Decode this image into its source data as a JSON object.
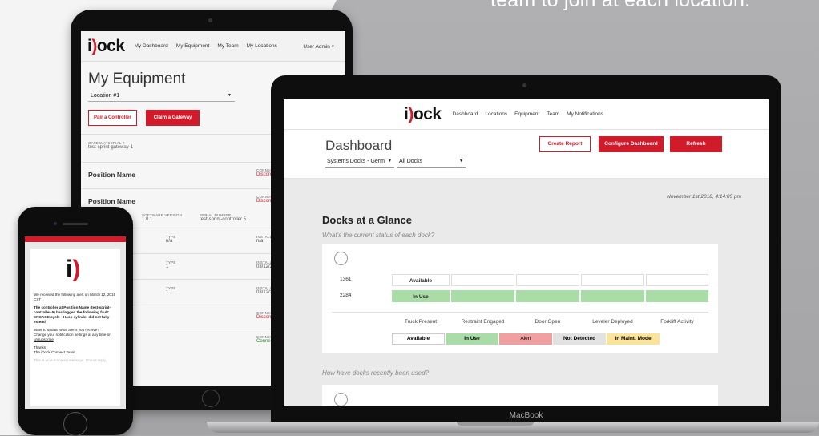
{
  "tagline": "team to join at each location.",
  "tablet": {
    "logo_left": "i",
    "logo_right": "ock",
    "nav": [
      "My Dashboard",
      "My Equipment",
      "My Team",
      "My Locations"
    ],
    "user": "User Admin ▾",
    "title": "My Equipment",
    "location_select": "Location #1",
    "pair_button": "Pair a Controller",
    "claim_button": "Claim a Gateway",
    "gateway_label": "GATEWAY SERIAL #",
    "gateway_value": "test-sprint-gateway-1",
    "position1": "Position Name",
    "connection_label": "CONNECTIV",
    "disconnected": "Disconne",
    "position2": "Position Name",
    "type_label_fragment": "E",
    "software_label": "SOFTWARE VERSION",
    "software_value": "1.0.1",
    "serial_label": "SERIAL NUMBER",
    "serial_value": "test-sprint-controller 5",
    "rows": [
      {
        "type_label": "TYPE",
        "type_value": "n/a",
        "install_label": "INSTALL D",
        "install_value": "n/a"
      },
      {
        "type_label": "TYPE",
        "type_value": "1",
        "install_label": "INSTALL D",
        "install_value": "03/12/20"
      },
      {
        "type_label": "TYPE",
        "type_value": "1",
        "install_label": "INSTALL D",
        "install_value": "03/12/20"
      }
    ],
    "conn_rows": [
      {
        "label": "CONNECTIV",
        "value": "Disconne",
        "fragment": "e",
        "status": "red"
      },
      {
        "label": "CONNECTIV",
        "value": "Connecte",
        "fragment": "e",
        "status": "green"
      }
    ]
  },
  "phone": {
    "intro": "We received the following alert on March 12, 2019 CST",
    "alert": "The controller at Position Name (test-sprint-controller-5) has logged the following fault: ENGAGE cycle - Hook cylinder did not fully extend",
    "update_q": "Want to update what alerts you receive?",
    "link1": "Change your notification settings",
    "link_mid": " at any time or ",
    "link2": "unsubscribe",
    "thanks": "Thanks,",
    "team": "The iDock Connect Team",
    "footer": "This is an automated message. Do not reply."
  },
  "laptop": {
    "logo_left": "i",
    "logo_right": "ock",
    "nav": [
      "Dashboard",
      "Locations",
      "Equipment",
      "Team",
      "My Notifications"
    ],
    "title": "Dashboard",
    "select1": "Systems Docks - Germ",
    "select2": "All Docks",
    "create_report": "Create Report",
    "configure": "Configure Dashboard",
    "refresh": "Refresh",
    "date": "November 1st 2018, 4:14:05 pm",
    "section_title": "Docks at a Glance",
    "question1": "What's the current status of each dock?",
    "info": "i",
    "docks": [
      {
        "id": "1361",
        "status": "Available"
      },
      {
        "id": "2284",
        "status": "In Use"
      }
    ],
    "columns": [
      "Truck Present",
      "Restraint Engaged",
      "Door Open",
      "Leveler Deployed",
      "Forklift Activity"
    ],
    "legend": [
      {
        "label": "Available",
        "color": "#ffffff"
      },
      {
        "label": "In Use",
        "color": "#a9dca6"
      },
      {
        "label": "Alert",
        "color": "#f0a0a0"
      },
      {
        "label": "Not Detected",
        "color": "#e2e2e2"
      },
      {
        "label": "In Maint. Mode",
        "color": "#fbe39a"
      }
    ],
    "question2": "How have docks recently been used?",
    "brand": "MacBook"
  },
  "colors": {
    "brand_red": "#d11a2a",
    "in_use_green": "#a9dca6"
  }
}
